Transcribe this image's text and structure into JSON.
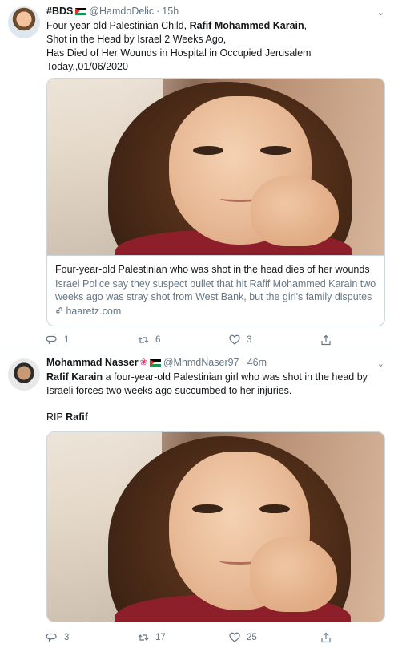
{
  "tweets": [
    {
      "name": "#BDS",
      "handle": "@HamdoDelic",
      "dot": "·",
      "time": "15h",
      "text_line1_prefix": "Four-year-old Palestinian Child, ",
      "text_line1_bold": "Rafif Mohammed Karain",
      "text_line1_suffix": ",",
      "text_line2": "Shot in the Head by Israel 2 Weeks Ago,",
      "text_line3": "Has Died of Her Wounds in Hospital in Occupied Jerusalem",
      "text_line4": "Today,,01/06/2020",
      "card": {
        "title": "Four-year-old Palestinian who was shot in the head dies of her wounds",
        "description": "Israel Police say they suspect bullet that hit Rafif Mohammed Karain two weeks ago was stray shot from West Bank, but the girl's family disputes ...",
        "domain": "haaretz.com"
      },
      "counts": {
        "replies": "1",
        "retweets": "6",
        "likes": "3"
      }
    },
    {
      "name": "Mohammad Nasser",
      "handle": "@MhmdNaser97",
      "dot": "·",
      "time": "46m",
      "text_bold": "Rafif Karain",
      "text_rest_line1": " a four-year-old Palestinian girl who was shot in the head by",
      "text_line2": "Israeli forces two weeks ago succumbed to her injuries.",
      "rip_prefix": "RIP ",
      "rip_bold": "Rafif",
      "counts": {
        "replies": "3",
        "retweets": "17",
        "likes": "25"
      }
    }
  ],
  "icons": {
    "more": "chevron-down-icon",
    "reply": "reply-icon",
    "retweet": "retweet-icon",
    "like": "heart-icon",
    "share": "share-icon",
    "link": "link-icon",
    "flag": "palestine-flag-icon",
    "flower": "rose-icon"
  },
  "colors": {
    "text": "#14171a",
    "secondary": "#657786",
    "border": "#ccd6dd",
    "divider": "#e6ecf0"
  }
}
